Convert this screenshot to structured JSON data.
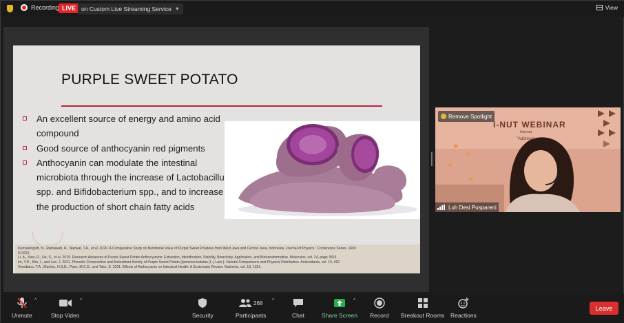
{
  "topbar": {
    "recording_label": "Recording",
    "live_badge": "LIVE",
    "live_service": "on Custom Live Streaming Service",
    "view_label": "View"
  },
  "slide": {
    "title": "PURPLE SWEET POTATO",
    "bullets": [
      "An excellent source of energy and amino acid compound",
      "Good source of anthocyanin red pigments",
      "Anthocyanin can modulate the intestinal microbiota through the increase of Lactobacillus spp. and Bifidobacterium spp., and to increase the production of short chain fatty acids"
    ],
    "references": [
      "Kurniasingsih, N., Ratnawati, R., Nazwar, T.A., et al. 2020. A Comparative Study on Nutritional Value of Purple Sweet Potatoes from West Java and Central Java, Indonesia. Journal of Physics : Conference Series. 1665",
      "012011",
      "Li, A., Xiao, R., He, S., et al. 2019. Research Advances of Purple Sweet Potato Anthocyanins: Extraction, Identification, Stability, Bioactivity, Application, and Biotransformation. Molecules, vol. 24, page 3816",
      "Im, Y.R., Kim, I., and Lee, J. 2021. Phenolic Composition and Antioxidant Activity of Purple Sweet Potato (Ipomoea batatas (L.) Lam.): Varietal Comparisons and Physical Distribution. Antioxidants, vol. 10, 462",
      "Verediano, T.A., Martino, H.S.D., Paes, M.C.D., and Tako, E. 2021. Effects of Anthocyanin on Intestinal Health: A Systematic Review. Nutrients, vol. 13, 1331."
    ]
  },
  "video": {
    "spotlight_label": "Remove Spotlight",
    "banner_title": "I-NUT WEBINAR",
    "banner_sub": "Internat",
    "banner_sub2": "\"Addressi",
    "participant_name": "Luh Desi Puspareni"
  },
  "toolbar": {
    "unmute": "Unmute",
    "stop_video": "Stop Video",
    "security": "Security",
    "participants": "Participants",
    "participants_count": "268",
    "chat": "Chat",
    "share_screen": "Share Screen",
    "record": "Record",
    "breakout_rooms": "Breakout Rooms",
    "reactions": "Reactions",
    "leave": "Leave"
  },
  "colors": {
    "accent_red": "#e0262b",
    "share_green": "#22b14c",
    "title_rule": "#b3283e",
    "leave": "#d9302f"
  },
  "icons": [
    "shield-icon",
    "record-dot-icon",
    "view-icon",
    "mic-muted-icon",
    "camera-icon",
    "security-shield-icon",
    "participants-icon",
    "chat-icon",
    "share-screen-icon",
    "record-icon",
    "breakout-rooms-icon",
    "reactions-icon",
    "signal-bars-icon"
  ]
}
